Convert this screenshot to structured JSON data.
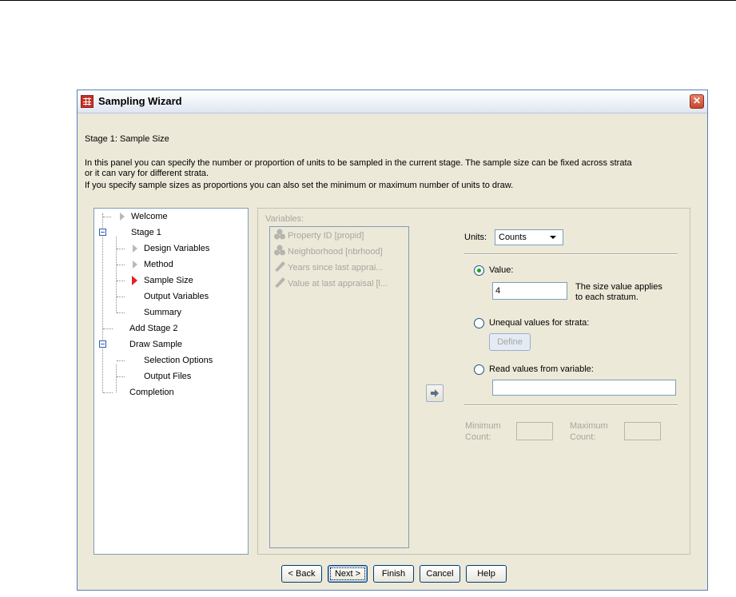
{
  "window": {
    "title": "Sampling Wizard",
    "close_glyph": "✕"
  },
  "stage_heading": "Stage 1: Sample Size",
  "instructions": [
    "In this panel you can specify the number or proportion of units to be sampled in the current stage. The sample size can be fixed across strata",
    "or it can vary for different strata.",
    "If you specify sample sizes as proportions you can also set the minimum or maximum number of units to draw."
  ],
  "tree": [
    {
      "label": "Welcome",
      "icon": "triangle-gray-icon"
    },
    {
      "label": "Stage 1",
      "icon": "collapse-box-icon"
    },
    {
      "label": "Design Variables",
      "icon": "triangle-gray-icon"
    },
    {
      "label": "Method",
      "icon": "triangle-gray-icon"
    },
    {
      "label": "Sample Size",
      "icon": "triangle-red-icon",
      "current": true
    },
    {
      "label": "Output Variables"
    },
    {
      "label": "Summary"
    },
    {
      "label": "Add Stage 2"
    },
    {
      "label": "Draw Sample",
      "icon": "collapse-box-icon"
    },
    {
      "label": "Selection Options"
    },
    {
      "label": "Output Files"
    },
    {
      "label": "Completion"
    }
  ],
  "variables": {
    "label": "Variables:",
    "items": [
      {
        "label": "Property ID [propid]",
        "icon": "nominal-icon"
      },
      {
        "label": "Neighborhood [nbrhood]",
        "icon": "nominal-icon"
      },
      {
        "label": "Years since last apprai...",
        "icon": "scale-ruler-icon"
      },
      {
        "label": "Value at last appraisal [l...",
        "icon": "scale-ruler-icon"
      }
    ]
  },
  "units": {
    "label": "Units:",
    "selected": "Counts"
  },
  "options": {
    "value_label": "Value:",
    "value_input": "4",
    "value_note_line1": "The size value applies",
    "value_note_line2": "to each stratum.",
    "unequal_label": "Unequal values for strata:",
    "define_label": "Define",
    "read_label": "Read values from variable:",
    "read_input": "",
    "selected": "value"
  },
  "minmax": {
    "min_line1": "Minimum",
    "min_line2": "Count:",
    "max_line1": "Maximum",
    "max_line2": "Count:"
  },
  "buttons": {
    "back": "< Back",
    "next": "Next >",
    "finish": "Finish",
    "cancel": "Cancel",
    "help": "Help"
  },
  "colors": {
    "dialog_bg": "#ece9d8",
    "current_marker": "#e02222",
    "disabled_text": "#a7a6a0"
  }
}
